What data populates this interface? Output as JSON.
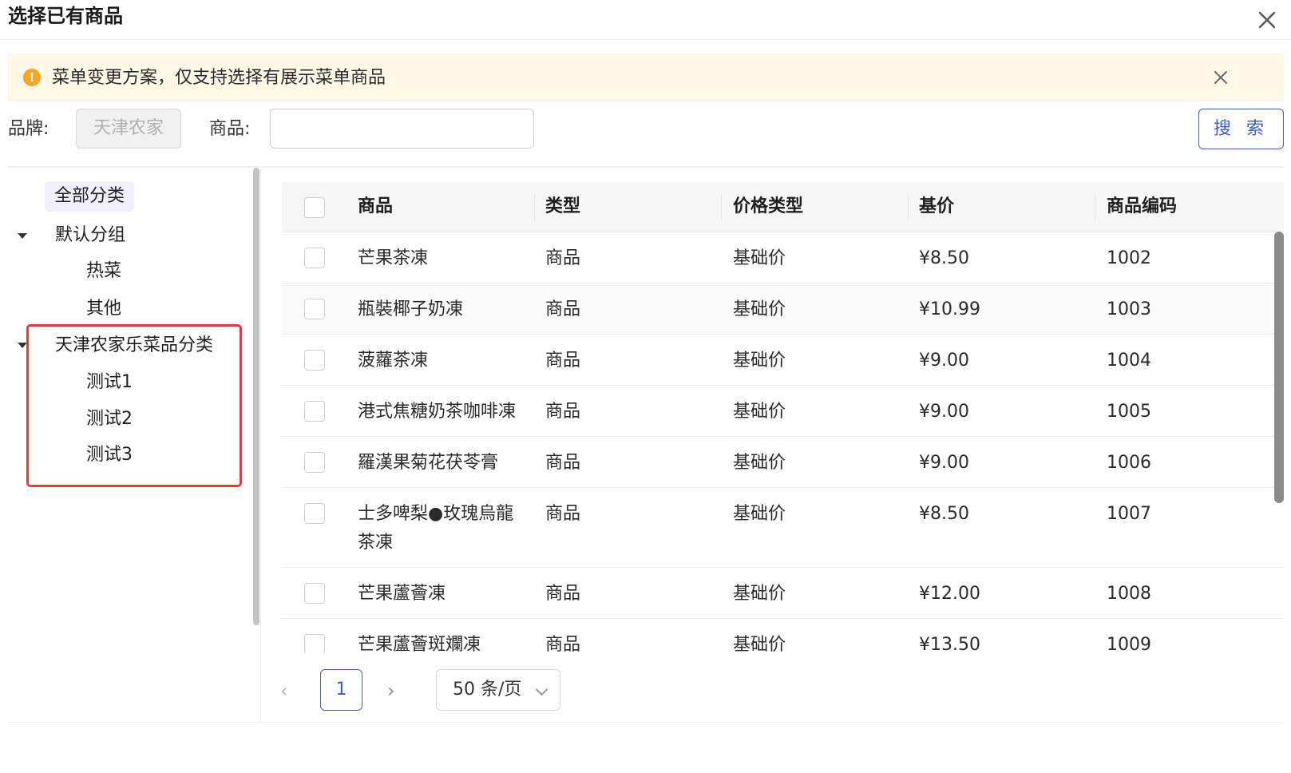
{
  "dialog": {
    "title": "选择已有商品"
  },
  "alert": {
    "text": "菜单变更方案，仅支持选择有展示菜单商品",
    "icon": "warning-icon",
    "color": "#f5a623"
  },
  "filter": {
    "brand_label": "品牌:",
    "brand_value": "天津农家",
    "product_label": "商品:",
    "product_value": "",
    "product_placeholder": "",
    "search_button": "搜 索"
  },
  "tree": {
    "all": "全部分类",
    "groups": [
      {
        "label": "默认分组",
        "children": [
          "热菜",
          "其他"
        ]
      },
      {
        "label": "天津农家乐菜品分类",
        "children": [
          "测试1",
          "测试2",
          "测试3"
        ]
      }
    ]
  },
  "table": {
    "columns": [
      "商品",
      "类型",
      "价格类型",
      "基价",
      "商品编码"
    ],
    "rows": [
      {
        "name": "芒果茶凍",
        "type": "商品",
        "price_type": "基础价",
        "price": "¥8.50",
        "code": "1002"
      },
      {
        "name": "瓶裝椰子奶凍",
        "type": "商品",
        "price_type": "基础价",
        "price": "¥10.99",
        "code": "1003"
      },
      {
        "name": "菠蘿茶凍",
        "type": "商品",
        "price_type": "基础价",
        "price": "¥9.00",
        "code": "1004"
      },
      {
        "name": "港式焦糖奶茶咖啡凍",
        "type": "商品",
        "price_type": "基础价",
        "price": "¥9.00",
        "code": "1005"
      },
      {
        "name": "羅漢果菊花茯苓膏",
        "type": "商品",
        "price_type": "基础价",
        "price": "¥9.00",
        "code": "1006"
      },
      {
        "name": "士多啤梨●玫瑰烏龍茶凍",
        "type": "商品",
        "price_type": "基础价",
        "price": "¥8.50",
        "code": "1007"
      },
      {
        "name": "芒果蘆薈凍",
        "type": "商品",
        "price_type": "基础价",
        "price": "¥12.00",
        "code": "1008"
      },
      {
        "name": "芒果蘆薈斑斕凍",
        "type": "商品",
        "price_type": "基础价",
        "price": "¥13.50",
        "code": "1009"
      }
    ]
  },
  "pagination": {
    "prev": "‹",
    "current_page": "1",
    "next": "›",
    "page_size": "50 条/页"
  },
  "colors": {
    "primary": "#3d5bdb",
    "highlight_border": "#e5393c",
    "alert_bg": "#fff8e6"
  }
}
